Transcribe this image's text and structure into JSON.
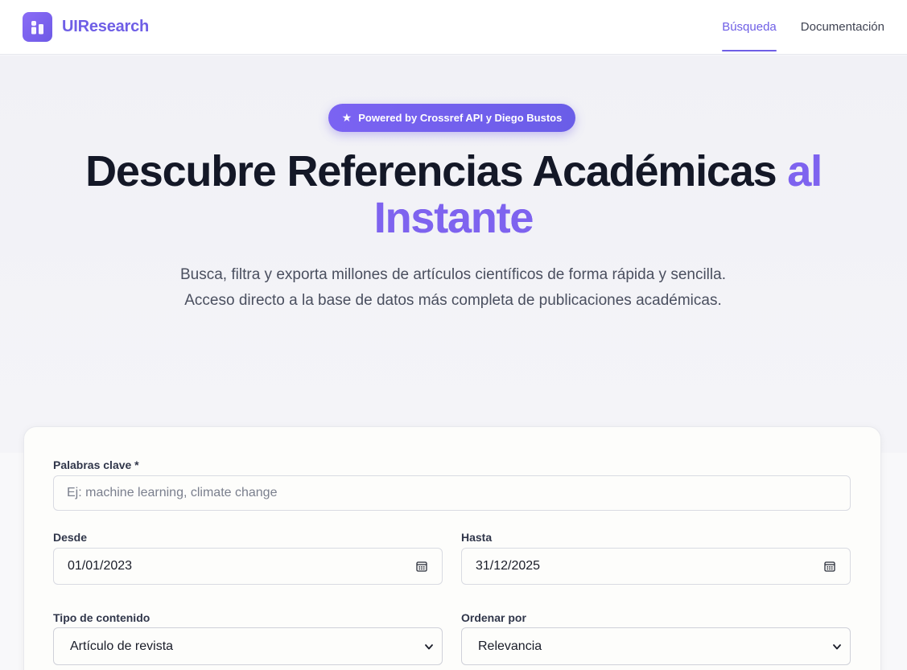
{
  "header": {
    "brand": "UIResearch",
    "nav": [
      {
        "label": "Búsqueda",
        "active": true
      },
      {
        "label": "Documentación",
        "active": false
      }
    ]
  },
  "hero": {
    "badge": "Powered by Crossref API y Diego Bustos",
    "title_main": "Descubre Referencias Académicas",
    "title_accent_1": "al",
    "title_accent_2": "Instante",
    "subtitle_line1": "Busca, filtra y exporta millones de artículos científicos de forma rápida y sencilla.",
    "subtitle_line2": "Acceso directo a la base de datos más completa de publicaciones académicas."
  },
  "form": {
    "keywords": {
      "label": "Palabras clave *",
      "placeholder": "Ej: machine learning, climate change",
      "value": ""
    },
    "from": {
      "label": "Desde",
      "value": "01/01/2023"
    },
    "to": {
      "label": "Hasta",
      "value": "31/12/2025"
    },
    "content_type": {
      "label": "Tipo de contenido",
      "value": "Artículo de revista"
    },
    "sort_by": {
      "label": "Ordenar por",
      "value": "Relevancia"
    }
  },
  "colors": {
    "accent": "#6f5fe6",
    "title": "#141827",
    "background": "#f1f1f6"
  },
  "icons": {
    "logo": "bar-chart-icon",
    "badge": "star-icon",
    "date": "calendar-icon",
    "select": "chevron-down-icon"
  }
}
